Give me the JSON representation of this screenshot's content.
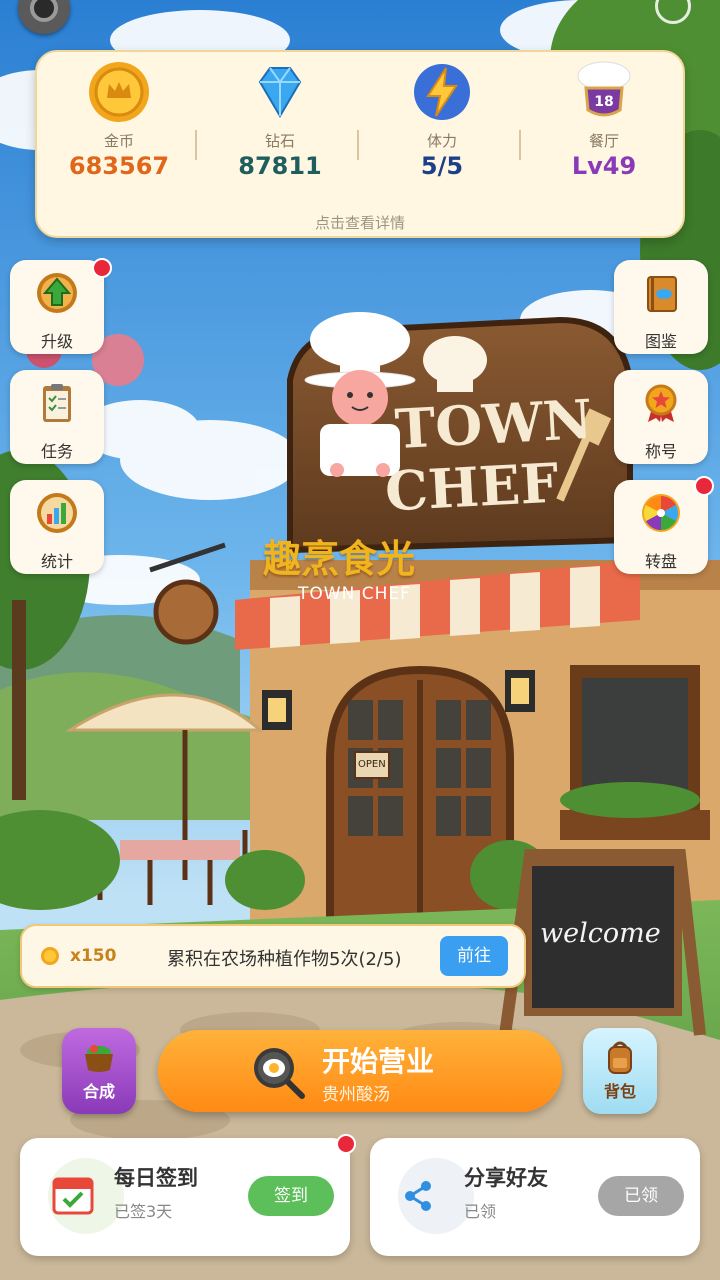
{
  "resources": [
    {
      "label": "金币",
      "value": "683567",
      "color": "#e0661a",
      "icon": "gold-coin-icon"
    },
    {
      "label": "钻石",
      "value": "87811",
      "color": "#1f5e5e",
      "icon": "diamond-icon"
    },
    {
      "label": "体力",
      "value": "5/5",
      "color": "#1c3f8a",
      "icon": "lightning-icon"
    },
    {
      "label": "餐厅",
      "value": "Lv49",
      "color": "#8a3ab8",
      "icon": "chef-hat-badge-icon",
      "badge": "18"
    }
  ],
  "resource_hint": "点击查看详情",
  "left_menu": [
    {
      "label": "升级",
      "icon": "upgrade-arrow-icon",
      "dot": true
    },
    {
      "label": "任务",
      "icon": "task-clipboard-icon",
      "dot": false
    },
    {
      "label": "统计",
      "icon": "stats-chart-icon",
      "dot": false
    }
  ],
  "right_menu": [
    {
      "label": "图鉴",
      "icon": "recipe-book-icon",
      "dot": false
    },
    {
      "label": "称号",
      "icon": "title-medal-icon",
      "dot": false
    },
    {
      "label": "转盘",
      "icon": "prize-wheel-icon",
      "dot": true
    }
  ],
  "scene": {
    "sign_line1": "TOWN",
    "sign_line2": "CHEF",
    "title_cn": "趣烹食光",
    "title_en": "TOWN CHEF",
    "door_sign": "OPEN",
    "board_text": "welcome"
  },
  "task": {
    "reward": "x150",
    "text": "累积在农场种植作物5次(2/5)",
    "button": "前往"
  },
  "actions": {
    "craft": "合成",
    "start_title": "开始营业",
    "start_sub": "贵州酸汤",
    "bag": "背包"
  },
  "cards": [
    {
      "title": "每日签到",
      "sub": "已签3天",
      "button": "签到",
      "button_color": "#5cbf5a",
      "icon": "calendar-check-icon",
      "dot": true
    },
    {
      "title": "分享好友",
      "sub": "已领",
      "button": "已领",
      "button_color": "#a6a6a6",
      "icon": "share-icon",
      "dot": false
    }
  ]
}
